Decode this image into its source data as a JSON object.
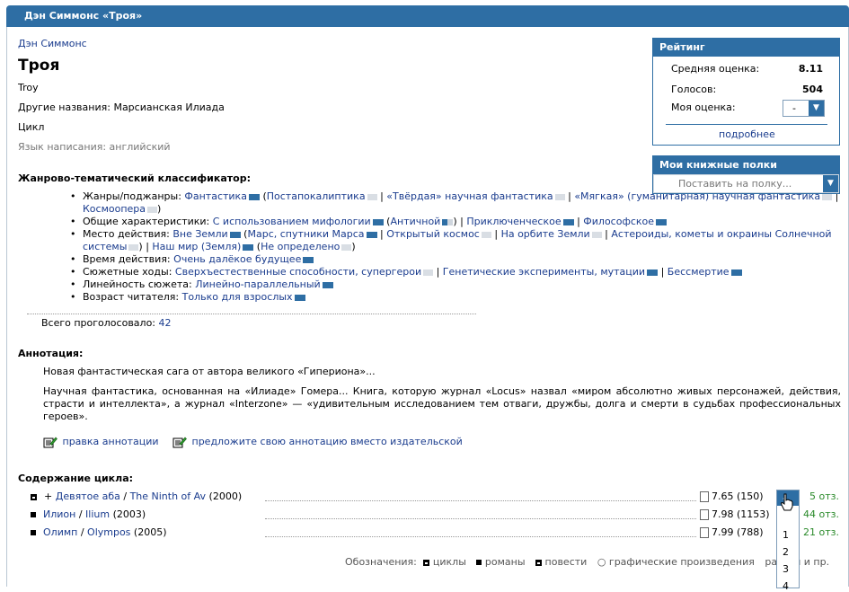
{
  "header": {
    "title": "Дэн Симмонс «Троя»"
  },
  "work": {
    "author": "Дэн Симмонс",
    "title": "Троя",
    "original_title": "Troy",
    "other_names_label": "Другие названия:",
    "other_names_value": "Марсианская Илиада",
    "type": "Цикл",
    "language": "Язык написания: английский"
  },
  "classifier": {
    "heading": "Жанрово-тематический классификатор:",
    "rows": [
      {
        "label": "Жанры/поджанры:",
        "items": [
          {
            "text": "Фантастика",
            "bar": "full",
            "prefix": "",
            "suffix": " ("
          },
          {
            "text": "Постапокалиптика",
            "bar": "pale",
            "suffix": " | "
          },
          {
            "text": "«Твёрдая» научная фантастика",
            "bar": "pale",
            "suffix": " | "
          },
          {
            "text": "«Мягкая» (гуманитарная) научная фантастика",
            "bar": "pale",
            "suffix": " | "
          },
          {
            "text": "Космоопера",
            "bar": "pale",
            "suffix": ")"
          }
        ]
      },
      {
        "label": "Общие характеристики:",
        "items": [
          {
            "text": "С использованием мифологии",
            "bar": "full",
            "suffix": " ("
          },
          {
            "text": "Античной",
            "bar": "half",
            "suffix": ") | "
          },
          {
            "text": "Приключенческое",
            "bar": "full",
            "suffix": " | "
          },
          {
            "text": "Философское",
            "bar": "full",
            "suffix": ""
          }
        ]
      },
      {
        "label": "Место действия:",
        "items": [
          {
            "text": "Вне Земли",
            "bar": "full",
            "suffix": " ("
          },
          {
            "text": "Марс, спутники Марса",
            "bar": "full",
            "suffix": " | "
          },
          {
            "text": "Открытый космос",
            "bar": "pale",
            "suffix": " | "
          },
          {
            "text": "На орбите Земли",
            "bar": "pale",
            "suffix": " | "
          },
          {
            "text": "Астероиды, кометы и окраины Солнечной системы",
            "bar": "pale",
            "suffix": ") | "
          },
          {
            "text": "Наш мир (Земля)",
            "bar": "full",
            "suffix": " ("
          },
          {
            "text": "Не определено",
            "bar": "pale",
            "suffix": ")"
          }
        ]
      },
      {
        "label": "Время действия:",
        "items": [
          {
            "text": "Очень далёкое будущее",
            "bar": "full",
            "suffix": ""
          }
        ]
      },
      {
        "label": "Сюжетные ходы:",
        "items": [
          {
            "text": "Сверхъестественные способности, супергерои",
            "bar": "pale",
            "suffix": " | "
          },
          {
            "text": "Генетические эксперименты, мутации",
            "bar": "full",
            "suffix": " | "
          },
          {
            "text": "Бессмертие",
            "bar": "full",
            "suffix": ""
          }
        ]
      },
      {
        "label": "Линейность сюжета:",
        "items": [
          {
            "text": "Линейно-параллельный",
            "bar": "full",
            "suffix": ""
          }
        ]
      },
      {
        "label": "Возраст читателя:",
        "items": [
          {
            "text": "Только для взрослых",
            "bar": "full",
            "suffix": ""
          }
        ]
      }
    ],
    "votes_label": "Всего проголосовало:",
    "votes_value": "42"
  },
  "annotation": {
    "heading": "Аннотация:",
    "p1": "Новая фантастическая сага от автора великого «Гипериона»...",
    "p2": "Научная фантастика, основанная на «Илиаде» Гомера... Книга, которую журнал «Locus» назвал «миром абсолютно живых персонажей, действия, страсти и интеллекта», а журнал «Interzone» — «удивительным исследованием тем отваги, дружбы, долга и смерти в судьбах профессиональных героев».",
    "edit_link": "правка аннотации",
    "suggest_link": "предложите свою аннотацию вместо издательской"
  },
  "contents": {
    "heading": "Содержание цикла:",
    "items": [
      {
        "prefix": "+ ",
        "ru": "Девятое аба",
        "en": "The Ninth of Av",
        "year": "(2000)",
        "rating": "7.65",
        "votes": "(150)",
        "reviews": "5 отз.",
        "marker": "hollow"
      },
      {
        "prefix": "",
        "ru": "Илион",
        "en": "Ilium",
        "year": "(2003)",
        "rating": "7.98",
        "votes": "(1153)",
        "reviews": "44 отз.",
        "marker": "solid"
      },
      {
        "prefix": "",
        "ru": "Олимп",
        "en": "Olympos",
        "year": "(2005)",
        "rating": "7.99",
        "votes": "(788)",
        "reviews": "21 отз.",
        "marker": "solid"
      }
    ],
    "legend_label": "Обозначения:",
    "legend": [
      "циклы",
      "романы",
      "повести",
      "графические произведения",
      "ра",
      "ы и пр."
    ]
  },
  "rating": {
    "heading": "Рейтинг",
    "avg_label": "Средняя оценка:",
    "avg_value": "8.11",
    "votes_label": "Голосов:",
    "votes_value": "504",
    "my_label": "Моя оценка:",
    "my_value": "-",
    "more_link": "подробнее"
  },
  "shelves": {
    "heading": "Мои книжные полки",
    "placeholder": "Поставить на полку..."
  },
  "dropdown": {
    "options": [
      "-",
      "1",
      "2",
      "3",
      "4"
    ]
  }
}
